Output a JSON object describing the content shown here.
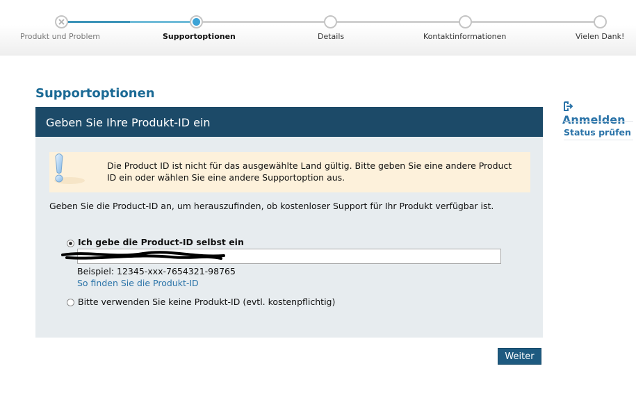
{
  "progress": {
    "steps": [
      {
        "label": "Produkt und Problem",
        "state": "done"
      },
      {
        "label": "Supportoptionen",
        "state": "active"
      },
      {
        "label": "Details",
        "state": "pending"
      },
      {
        "label": "Kontaktinformationen",
        "state": "pending"
      },
      {
        "label": "Vielen Dank!",
        "state": "pending"
      }
    ]
  },
  "page": {
    "title": "Supportoptionen"
  },
  "panel": {
    "heading": "Geben Sie Ihre Produkt-ID ein",
    "notice": "Die Product ID ist nicht für das ausgewählte Land gültig. Bitte geben Sie eine andere Product ID ein oder wählen Sie eine andere Supportoption aus.",
    "intro": "Geben Sie die Product-ID an, um herauszufinden, ob kostenloser Support für Ihr Produkt verfügbar ist.",
    "option_manual": {
      "label": "Ich gebe die Product-ID selbst ein",
      "selected": true
    },
    "product_id_value": "",
    "example": "Beispiel: 12345-xxx-7654321-98765",
    "help_link": "So finden Sie die Produkt-ID",
    "option_none": {
      "label": "Bitte verwenden Sie keine Produkt-ID (evtl. kostenpflichtig)",
      "selected": false
    }
  },
  "actions": {
    "continue_label": "Weiter"
  },
  "sidebar": {
    "login_label": "Anmelden",
    "status_label": "Status prüfen"
  },
  "colors": {
    "accent": "#1b6a95",
    "panel_header": "#1c4a68",
    "notice_bg": "#fdf1db",
    "progress_active": "#3da3d6"
  }
}
